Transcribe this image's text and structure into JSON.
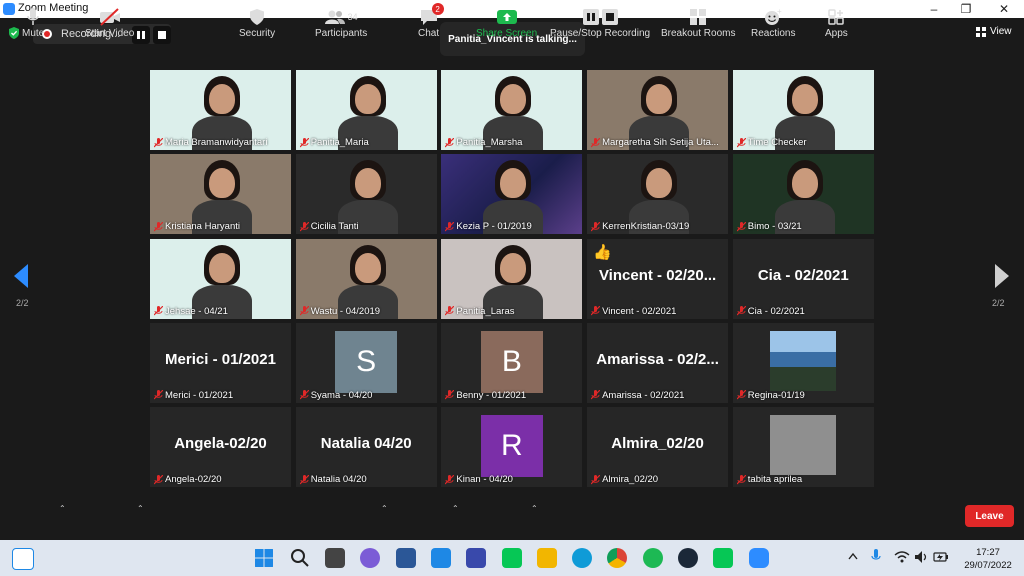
{
  "window": {
    "title": "Zoom Meeting"
  },
  "recording": {
    "label": "Recording..."
  },
  "talking": "Panitia_Vincent is talking...",
  "view_label": "View",
  "pagination": {
    "left": "2/2",
    "right": "2/2"
  },
  "participants": [
    {
      "name": "Maria Bramanwidyantari",
      "kind": "video",
      "scene": "white"
    },
    {
      "name": "Panitia_Maria",
      "kind": "video",
      "scene": "white"
    },
    {
      "name": "Panitia_Marsha",
      "kind": "video",
      "scene": "white"
    },
    {
      "name": "Margaretha Sih Setija Uta...",
      "kind": "video",
      "scene": "room"
    },
    {
      "name": "Time Checker",
      "kind": "video",
      "scene": "white"
    },
    {
      "name": "Kristiana Haryanti",
      "kind": "video",
      "scene": "room"
    },
    {
      "name": "Cicilia Tanti",
      "kind": "video",
      "scene": "dark"
    },
    {
      "name": "Kezia P - 01/2019",
      "kind": "video",
      "scene": "galaxy"
    },
    {
      "name": "KerrenKristian-03/19",
      "kind": "video",
      "scene": "dark"
    },
    {
      "name": "Bimo - 03/21",
      "kind": "video",
      "scene": "green"
    },
    {
      "name": "Jehsae - 04/21",
      "kind": "video",
      "scene": "white"
    },
    {
      "name": "Wastu - 04/2019",
      "kind": "video",
      "scene": "room"
    },
    {
      "name": "Panitia_Laras",
      "kind": "video",
      "scene": "light"
    },
    {
      "name": "Vincent - 02/2021",
      "kind": "name",
      "display": "Vincent - 02/20...",
      "reaction": "👍"
    },
    {
      "name": "Cia - 02/2021",
      "kind": "name",
      "display": "Cia - 02/2021"
    },
    {
      "name": "Merici - 01/2021",
      "kind": "name",
      "display": "Merici - 01/2021"
    },
    {
      "name": "Syama - 04/20",
      "kind": "avatar",
      "letter": "S",
      "color": "#6f8490"
    },
    {
      "name": "Benny - 01/2021",
      "kind": "avatar",
      "letter": "B",
      "color": "#8a6a5c"
    },
    {
      "name": "Amarissa - 02/2021",
      "kind": "name",
      "display": "Amarissa - 02/2..."
    },
    {
      "name": "Regina-01/19",
      "kind": "photo",
      "scene": "sea"
    },
    {
      "name": "Angela-02/20",
      "kind": "name",
      "display": "Angela-02/20"
    },
    {
      "name": "Natalia 04/20",
      "kind": "name",
      "display": "Natalia 04/20"
    },
    {
      "name": "Kinan - 04/20",
      "kind": "avatar",
      "letter": "R",
      "color": "#7b2fa8"
    },
    {
      "name": "Almira_02/20",
      "kind": "name",
      "display": "Almira_02/20"
    },
    {
      "name": "tabita aprilea",
      "kind": "photo",
      "scene": "chat"
    }
  ],
  "toolbar": {
    "mute": "Mute",
    "start_video": "Start Video",
    "security": "Security",
    "participants": "Participants",
    "participants_count": "34",
    "chat": "Chat",
    "chat_badge": "2",
    "share_screen": "Share Screen",
    "pause_stop_recording": "Pause/Stop Recording",
    "breakout_rooms": "Breakout Rooms",
    "reactions": "Reactions",
    "apps": "Apps",
    "leave": "Leave"
  },
  "taskbar": {
    "time": "17:27",
    "date": "29/07/2022"
  },
  "colors": {
    "accent": "#2d8cff",
    "share_green": "#1dba4e",
    "leave_red": "#e02828"
  }
}
